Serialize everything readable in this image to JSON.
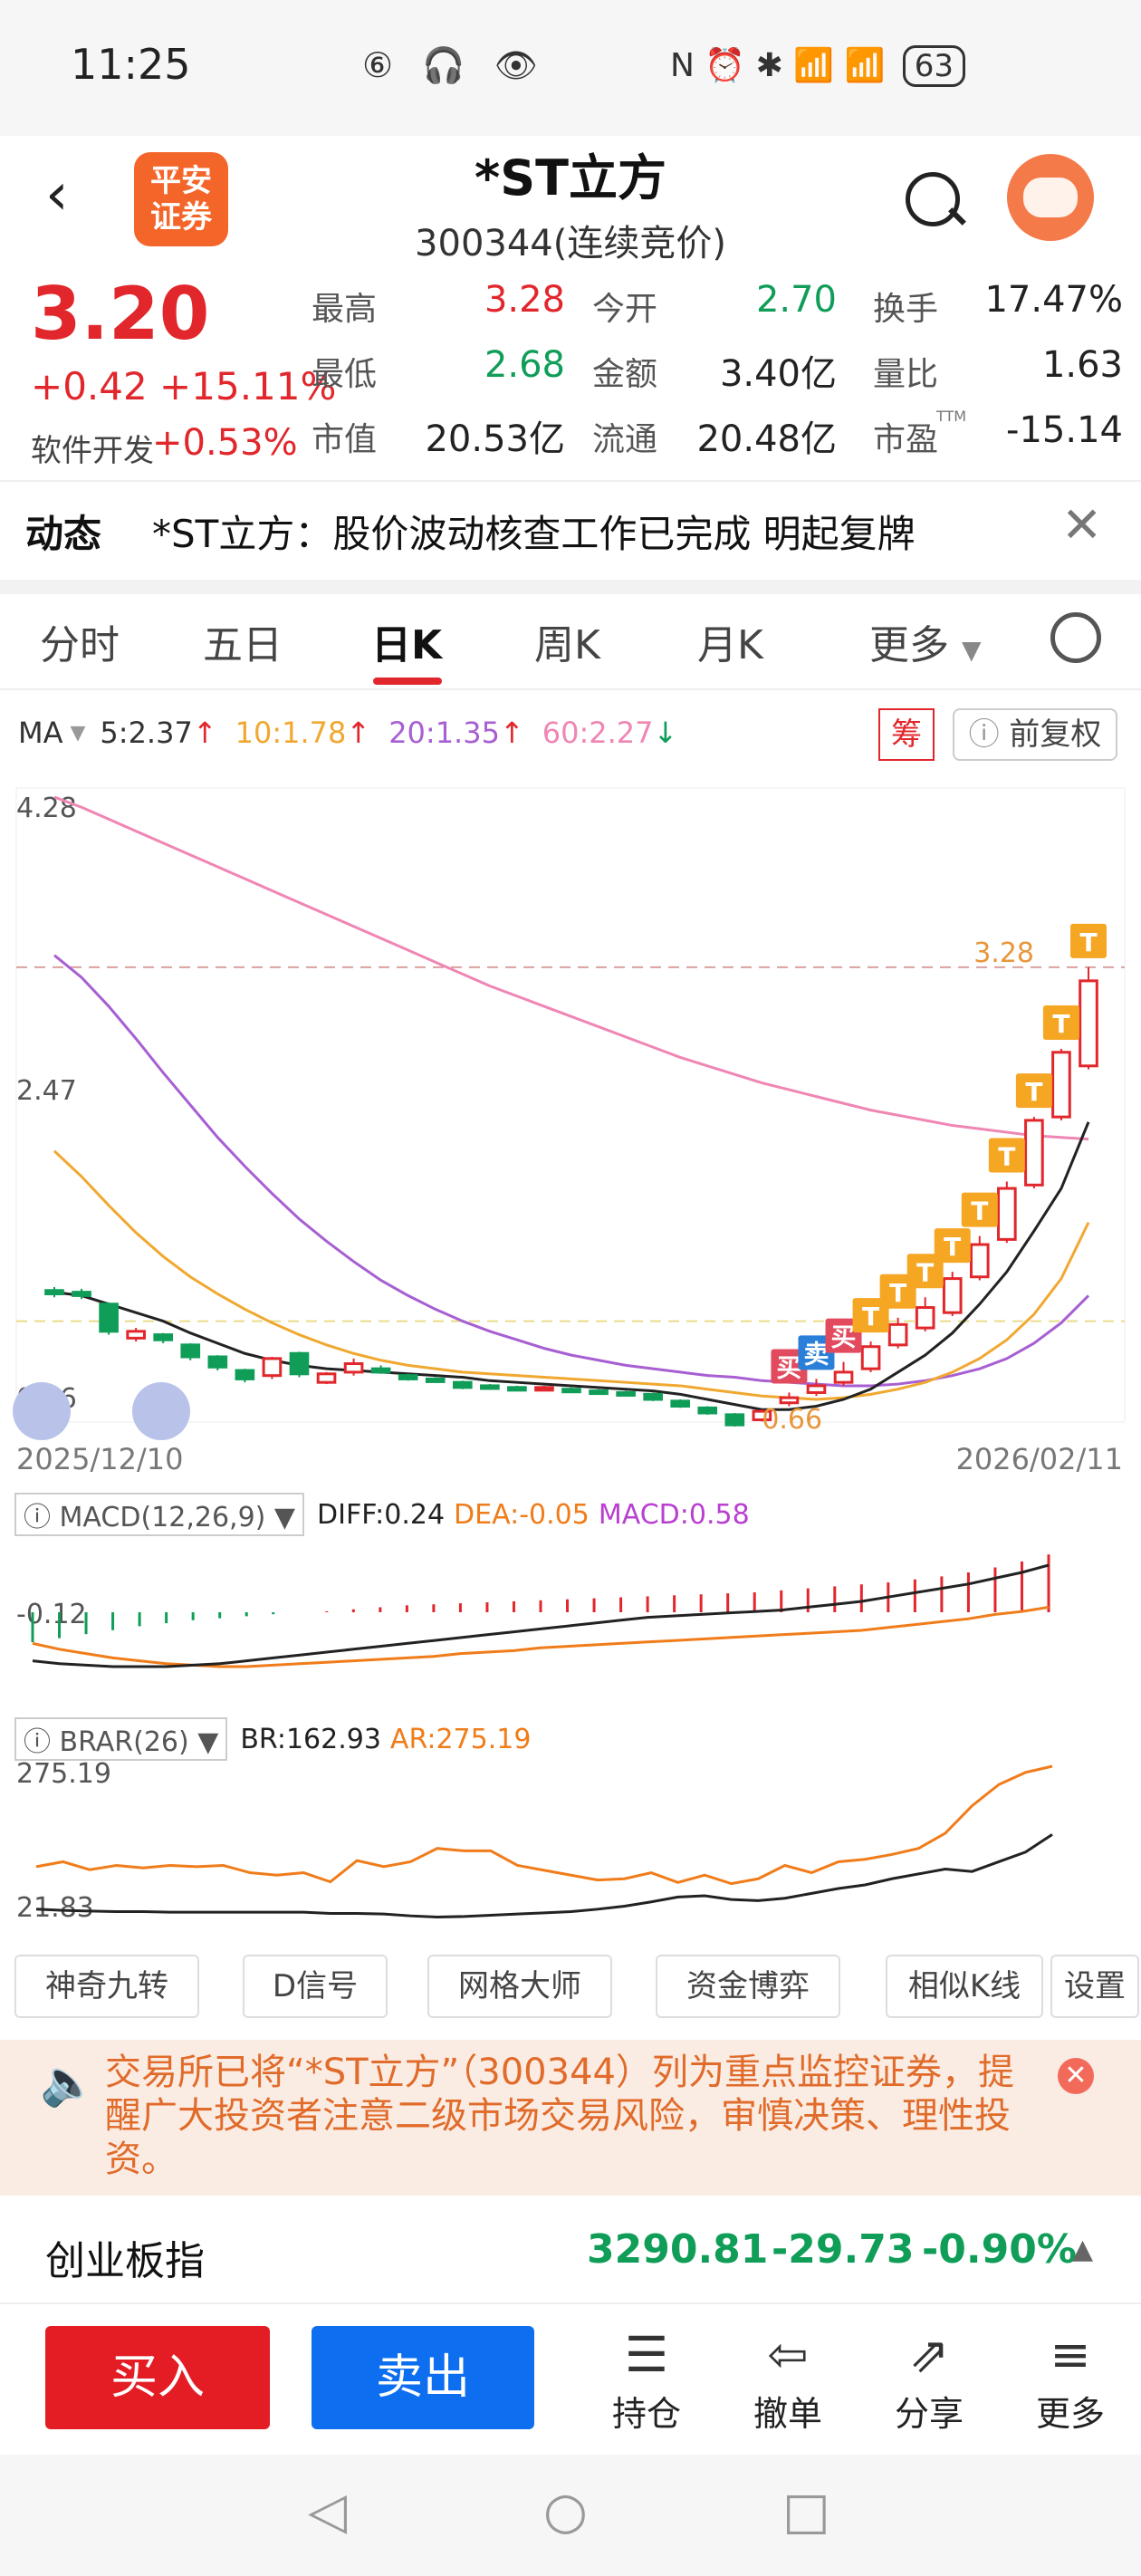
{
  "status_bar": {
    "time": "11:25",
    "left_icons": "⑥ 🎧 👁",
    "right_icons": "N ⏰ ✱ 📶 📶",
    "battery": "63"
  },
  "header": {
    "back": "‹",
    "broker_logo_line1": "平安",
    "broker_logo_line2": "证券",
    "stock_name": "*ST立方",
    "stock_code": "300344(连续竞价)"
  },
  "quote": {
    "price": "3.20",
    "change": "+0.42 +15.11%",
    "industry_label": "软件开发",
    "industry_change": "+0.53%",
    "fields": [
      {
        "label": "最高",
        "value": "3.28",
        "color": "#e1272c"
      },
      {
        "label": "今开",
        "value": "2.70",
        "color": "#0f9d58"
      },
      {
        "label": "换手",
        "value": "17.47%",
        "color": "#222222"
      },
      {
        "label": "最低",
        "value": "2.68",
        "color": "#0f9d58"
      },
      {
        "label": "金额",
        "value": "3.40亿",
        "color": "#222222"
      },
      {
        "label": "量比",
        "value": "1.63",
        "color": "#222222"
      },
      {
        "label": "市值",
        "value": "20.53亿",
        "color": "#222222"
      },
      {
        "label": "流通",
        "value": "20.48亿",
        "color": "#222222"
      },
      {
        "label": "市盈",
        "value": "-15.14",
        "color": "#222222"
      }
    ],
    "pe_suffix": "TTM"
  },
  "news": {
    "label": "动态",
    "text": "*ST立方：股价波动核查工作已完成 明起复牌",
    "close": "✕"
  },
  "tabs": [
    "分时",
    "五日",
    "日K",
    "周K",
    "月K",
    "更多"
  ],
  "active_tab": "日K",
  "ma_legend": {
    "label": "MA",
    "ma5": "5:2.37",
    "ma10": "10:1.78",
    "ma20": "20:1.35",
    "ma60": "60:2.27",
    "colors": {
      "ma5": "#222222",
      "ma10": "#f0a830",
      "ma20": "#a75fd2",
      "ma60": "#ef86b4"
    }
  },
  "chou_badge": "筹",
  "fuquan": "前复权",
  "chart_data": [
    {
      "type": "candlestick",
      "title": "",
      "y_axis_labels": [
        "4.28",
        "2.47",
        "0.66"
      ],
      "ylim": [
        0.66,
        4.28
      ],
      "start_date": "2025/12/10",
      "end_date": "2026/02/11",
      "high_marker": "3.28",
      "low_marker": "0.66",
      "candles": [
        {
          "o": 1.38,
          "c": 1.36,
          "h": 1.4,
          "l": 1.34
        },
        {
          "o": 1.37,
          "c": 1.35,
          "h": 1.39,
          "l": 1.33
        },
        {
          "o": 1.3,
          "c": 1.14,
          "h": 1.31,
          "l": 1.12
        },
        {
          "o": 1.1,
          "c": 1.14,
          "h": 1.16,
          "l": 1.08
        },
        {
          "o": 1.12,
          "c": 1.09,
          "h": 1.13,
          "l": 1.07
        },
        {
          "o": 1.06,
          "c": 0.99,
          "h": 1.07,
          "l": 0.97
        },
        {
          "o": 0.99,
          "c": 0.93,
          "h": 1.0,
          "l": 0.91
        },
        {
          "o": 0.91,
          "c": 0.86,
          "h": 0.92,
          "l": 0.84
        },
        {
          "o": 0.88,
          "c": 0.98,
          "h": 0.99,
          "l": 0.86
        },
        {
          "o": 1.01,
          "c": 0.89,
          "h": 1.02,
          "l": 0.87
        },
        {
          "o": 0.84,
          "c": 0.89,
          "h": 0.9,
          "l": 0.83
        },
        {
          "o": 0.9,
          "c": 0.95,
          "h": 0.98,
          "l": 0.88
        },
        {
          "o": 0.92,
          "c": 0.9,
          "h": 0.94,
          "l": 0.89
        },
        {
          "o": 0.88,
          "c": 0.86,
          "h": 0.89,
          "l": 0.85
        },
        {
          "o": 0.86,
          "c": 0.85,
          "h": 0.87,
          "l": 0.84
        },
        {
          "o": 0.84,
          "c": 0.81,
          "h": 0.85,
          "l": 0.8
        },
        {
          "o": 0.82,
          "c": 0.81,
          "h": 0.83,
          "l": 0.8
        },
        {
          "o": 0.81,
          "c": 0.8,
          "h": 0.82,
          "l": 0.79
        },
        {
          "o": 0.8,
          "c": 0.81,
          "h": 0.82,
          "l": 0.79
        },
        {
          "o": 0.8,
          "c": 0.79,
          "h": 0.81,
          "l": 0.78
        },
        {
          "o": 0.79,
          "c": 0.78,
          "h": 0.8,
          "l": 0.77
        },
        {
          "o": 0.78,
          "c": 0.77,
          "h": 0.79,
          "l": 0.76
        },
        {
          "o": 0.77,
          "c": 0.74,
          "h": 0.78,
          "l": 0.73
        },
        {
          "o": 0.73,
          "c": 0.7,
          "h": 0.74,
          "l": 0.69
        },
        {
          "o": 0.69,
          "c": 0.66,
          "h": 0.7,
          "l": 0.65
        },
        {
          "o": 0.65,
          "c": 0.59,
          "h": 0.66,
          "l": 0.58
        },
        {
          "o": 0.62,
          "c": 0.67,
          "h": 0.68,
          "l": 0.61
        },
        {
          "o": 0.72,
          "c": 0.75,
          "h": 0.78,
          "l": 0.7
        },
        {
          "o": 0.78,
          "c": 0.82,
          "h": 0.86,
          "l": 0.76
        },
        {
          "o": 0.84,
          "c": 0.9,
          "h": 0.96,
          "l": 0.82
        },
        {
          "o": 0.92,
          "c": 1.05,
          "h": 1.08,
          "l": 0.9
        },
        {
          "o": 1.06,
          "c": 1.18,
          "h": 1.22,
          "l": 1.04
        },
        {
          "o": 1.16,
          "c": 1.28,
          "h": 1.34,
          "l": 1.14
        },
        {
          "o": 1.25,
          "c": 1.45,
          "h": 1.49,
          "l": 1.23
        },
        {
          "o": 1.46,
          "c": 1.65,
          "h": 1.7,
          "l": 1.44
        },
        {
          "o": 1.68,
          "c": 1.98,
          "h": 2.02,
          "l": 1.66
        },
        {
          "o": 2.0,
          "c": 2.38,
          "h": 2.4,
          "l": 1.98
        },
        {
          "o": 2.4,
          "c": 2.78,
          "h": 2.8,
          "l": 2.38
        },
        {
          "o": 2.7,
          "c": 3.2,
          "h": 3.28,
          "l": 2.68
        }
      ],
      "ma5": [
        1.37,
        1.35,
        1.3,
        1.25,
        1.2,
        1.13,
        1.07,
        1.01,
        0.97,
        0.94,
        0.92,
        0.91,
        0.9,
        0.89,
        0.88,
        0.87,
        0.85,
        0.84,
        0.83,
        0.82,
        0.81,
        0.8,
        0.79,
        0.77,
        0.74,
        0.71,
        0.68,
        0.68,
        0.7,
        0.74,
        0.8,
        0.9,
        1.0,
        1.13,
        1.3,
        1.49,
        1.73,
        1.98,
        2.37
      ],
      "ma10": [
        2.2,
        2.05,
        1.88,
        1.72,
        1.58,
        1.46,
        1.36,
        1.27,
        1.19,
        1.12,
        1.06,
        1.01,
        0.97,
        0.94,
        0.92,
        0.9,
        0.89,
        0.88,
        0.87,
        0.86,
        0.85,
        0.84,
        0.83,
        0.82,
        0.8,
        0.78,
        0.76,
        0.75,
        0.74,
        0.75,
        0.77,
        0.8,
        0.84,
        0.9,
        0.98,
        1.09,
        1.24,
        1.45,
        1.78
      ],
      "ma20": [
        3.35,
        3.22,
        3.05,
        2.86,
        2.66,
        2.47,
        2.28,
        2.11,
        1.95,
        1.8,
        1.67,
        1.55,
        1.44,
        1.35,
        1.27,
        1.2,
        1.14,
        1.09,
        1.04,
        1.0,
        0.97,
        0.94,
        0.92,
        0.9,
        0.88,
        0.87,
        0.85,
        0.84,
        0.83,
        0.82,
        0.82,
        0.83,
        0.85,
        0.88,
        0.92,
        0.98,
        1.07,
        1.19,
        1.35
      ],
      "ma60": [
        4.28,
        4.22,
        4.15,
        4.08,
        4.01,
        3.94,
        3.87,
        3.8,
        3.73,
        3.66,
        3.59,
        3.52,
        3.45,
        3.38,
        3.31,
        3.24,
        3.17,
        3.11,
        3.05,
        2.99,
        2.93,
        2.87,
        2.81,
        2.75,
        2.7,
        2.65,
        2.6,
        2.56,
        2.52,
        2.48,
        2.44,
        2.41,
        2.38,
        2.35,
        2.33,
        2.31,
        2.29,
        2.28,
        2.27
      ],
      "trade_marks": [
        {
          "index": 27,
          "label": "买",
          "kind": "buy"
        },
        {
          "index": 28,
          "label": "卖",
          "kind": "sell"
        },
        {
          "index": 29,
          "label": "买",
          "kind": "buy"
        },
        {
          "index": 30,
          "label": "T",
          "kind": "t"
        },
        {
          "index": 31,
          "label": "T",
          "kind": "t"
        },
        {
          "index": 32,
          "label": "T",
          "kind": "t"
        },
        {
          "index": 33,
          "label": "T",
          "kind": "t"
        },
        {
          "index": 34,
          "label": "T",
          "kind": "t"
        },
        {
          "index": 35,
          "label": "T",
          "kind": "t"
        },
        {
          "index": 36,
          "label": "T",
          "kind": "t"
        },
        {
          "index": 37,
          "label": "T",
          "kind": "t"
        },
        {
          "index": 38,
          "label": "T",
          "kind": "t"
        }
      ]
    },
    {
      "type": "bar",
      "title": "MACD(12,26,9)",
      "legend": {
        "diff": "DIFF:0.24",
        "dea": "DEA:-0.05",
        "macd": "MACD:0.58"
      },
      "y_label": "-0.12",
      "macd": [
        -0.3,
        -0.26,
        -0.22,
        -0.18,
        -0.14,
        -0.11,
        -0.08,
        -0.06,
        -0.04,
        -0.02,
        0.0,
        0.01,
        0.03,
        0.05,
        0.07,
        0.08,
        0.09,
        0.1,
        0.11,
        0.12,
        0.13,
        0.14,
        0.15,
        0.16,
        0.17,
        0.18,
        0.19,
        0.2,
        0.22,
        0.24,
        0.26,
        0.28,
        0.3,
        0.33,
        0.36,
        0.4,
        0.45,
        0.51,
        0.58
      ],
      "diff": [
        -0.42,
        -0.44,
        -0.45,
        -0.46,
        -0.46,
        -0.46,
        -0.45,
        -0.44,
        -0.42,
        -0.4,
        -0.38,
        -0.36,
        -0.34,
        -0.32,
        -0.3,
        -0.28,
        -0.26,
        -0.24,
        -0.22,
        -0.2,
        -0.18,
        -0.16,
        -0.14,
        -0.12,
        -0.11,
        -0.1,
        -0.09,
        -0.08,
        -0.07,
        -0.05,
        -0.03,
        -0.01,
        0.02,
        0.05,
        0.08,
        0.11,
        0.15,
        0.19,
        0.24
      ],
      "dea": [
        -0.3,
        -0.34,
        -0.37,
        -0.4,
        -0.42,
        -0.44,
        -0.45,
        -0.46,
        -0.46,
        -0.45,
        -0.44,
        -0.43,
        -0.42,
        -0.41,
        -0.4,
        -0.39,
        -0.37,
        -0.36,
        -0.35,
        -0.33,
        -0.32,
        -0.31,
        -0.3,
        -0.29,
        -0.28,
        -0.27,
        -0.26,
        -0.25,
        -0.24,
        -0.23,
        -0.22,
        -0.21,
        -0.19,
        -0.17,
        -0.15,
        -0.13,
        -0.1,
        -0.08,
        -0.05
      ]
    },
    {
      "type": "line",
      "title": "BRAR(26)",
      "legend": {
        "br": "BR:162.93",
        "ar": "AR:275.19"
      },
      "y_axis_labels": [
        "275.19",
        "21.83"
      ],
      "ylim": [
        21.83,
        275.19
      ],
      "br": [
        40,
        38,
        37,
        36,
        36,
        35,
        35,
        35,
        35,
        35,
        35,
        33,
        33,
        32,
        29,
        27,
        28,
        30,
        32,
        34,
        36,
        40,
        45,
        52,
        60,
        62,
        56,
        54,
        58,
        66,
        74,
        80,
        90,
        98,
        106,
        102,
        118,
        134,
        162.93
      ],
      "ar": [
        110,
        118,
        105,
        112,
        108,
        112,
        110,
        112,
        100,
        96,
        100,
        85,
        120,
        110,
        118,
        140,
        136,
        136,
        112,
        104,
        96,
        88,
        90,
        100,
        84,
        96,
        82,
        90,
        112,
        100,
        118,
        122,
        130,
        140,
        165,
        210,
        245,
        265,
        275.19
      ]
    }
  ],
  "indicator_buttons": [
    "神奇九转",
    "D信号",
    "网格大师",
    "资金博弈",
    "相似K线",
    "设置"
  ],
  "warning": {
    "text": "交易所已将“*ST立方”（300344）列为重点监控证券，提醒广大投资者注意二级市场交易风险，审慎决策、理性投资。",
    "close": "✕"
  },
  "index": {
    "name": "创业板指",
    "value": "3290.81",
    "change": "-29.73",
    "pct": "-0.90%",
    "arrow": "▲"
  },
  "actions": {
    "buy": "买入",
    "sell": "卖出",
    "items": [
      {
        "label": "持仓",
        "icon": "☰"
      },
      {
        "label": "撤单",
        "icon": "⇦"
      },
      {
        "label": "分享",
        "icon": "⇗"
      },
      {
        "label": "更多",
        "icon": "≡"
      }
    ]
  },
  "nav": {
    "back": "◁",
    "home": "○",
    "recent": "□"
  }
}
